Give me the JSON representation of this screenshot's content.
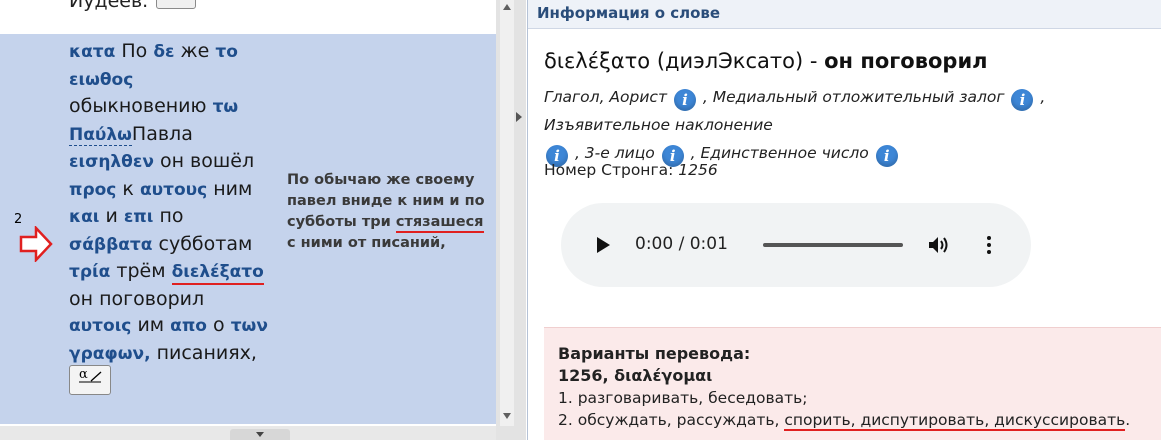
{
  "left": {
    "prev_text": "Иудеев.",
    "verse_number": "2",
    "interlinear": [
      {
        "greek": "κατα",
        "russian": "По"
      },
      {
        "greek": "δε",
        "russian": "же"
      },
      {
        "greek": "το",
        "russian": ""
      },
      {
        "greek": "ειωθος",
        "russian": "обыкновению"
      },
      {
        "greek": "τω",
        "russian": ""
      },
      {
        "greek": "Παύλω",
        "russian": "Павла"
      },
      {
        "greek": "εισηλθεν",
        "russian": "он вошёл"
      },
      {
        "greek": "προς",
        "russian": "к"
      },
      {
        "greek": "αυτους",
        "russian": "ним"
      },
      {
        "greek": "και",
        "russian": "и"
      },
      {
        "greek": "επι",
        "russian": "по"
      },
      {
        "greek": "σάββατα",
        "russian": "субботам"
      },
      {
        "greek": "τρία",
        "russian": "трём"
      },
      {
        "greek": "διελέξατο",
        "russian": "он поговорил"
      },
      {
        "greek": "αυτοις",
        "russian": "им"
      },
      {
        "greek": "απο",
        "russian": "о"
      },
      {
        "greek": "των",
        "russian": ""
      },
      {
        "greek": "γραφων,",
        "russian": "писаниях,"
      }
    ],
    "translation_part1": "По обычаю же своему павел вниде к ним и по субботы три ",
    "translation_underlined": "стязашеся",
    "translation_part2": " с ними от писаний,",
    "strong_button_label": "α"
  },
  "right": {
    "panel_title": "Информация о слове",
    "word_greek": "διελέξατο",
    "word_translit": "(диэлЭксато)",
    "word_dash": "-",
    "word_meaning": "он поговорил",
    "morph": [
      "Глагол, Аорист",
      ", Медиальный отложительный залог",
      ", Изъявительное наклонение",
      ", 3-е лицо",
      ", Единственное число"
    ],
    "strong_label": "Номер Стронга:",
    "strong_number": "1256",
    "audio_time": "0:00 / 0:01",
    "variants_title": "Варианты перевода:",
    "variants_lemma": "1256, διαλέγομαι",
    "variant1": "1. разговаривать, беседовать;",
    "variant2_plain": "2. обсуждать, рассуждать, ",
    "variant2_underlined": "спорить, диспутировать, дискуссировать",
    "variant2_end": "."
  },
  "colors": {
    "verse_bg": "#c5d3ec",
    "greek_text": "#1f4e8c",
    "underline": "#e02020",
    "info_icon": "#3d86d6",
    "variants_bg": "#fbeaea"
  }
}
